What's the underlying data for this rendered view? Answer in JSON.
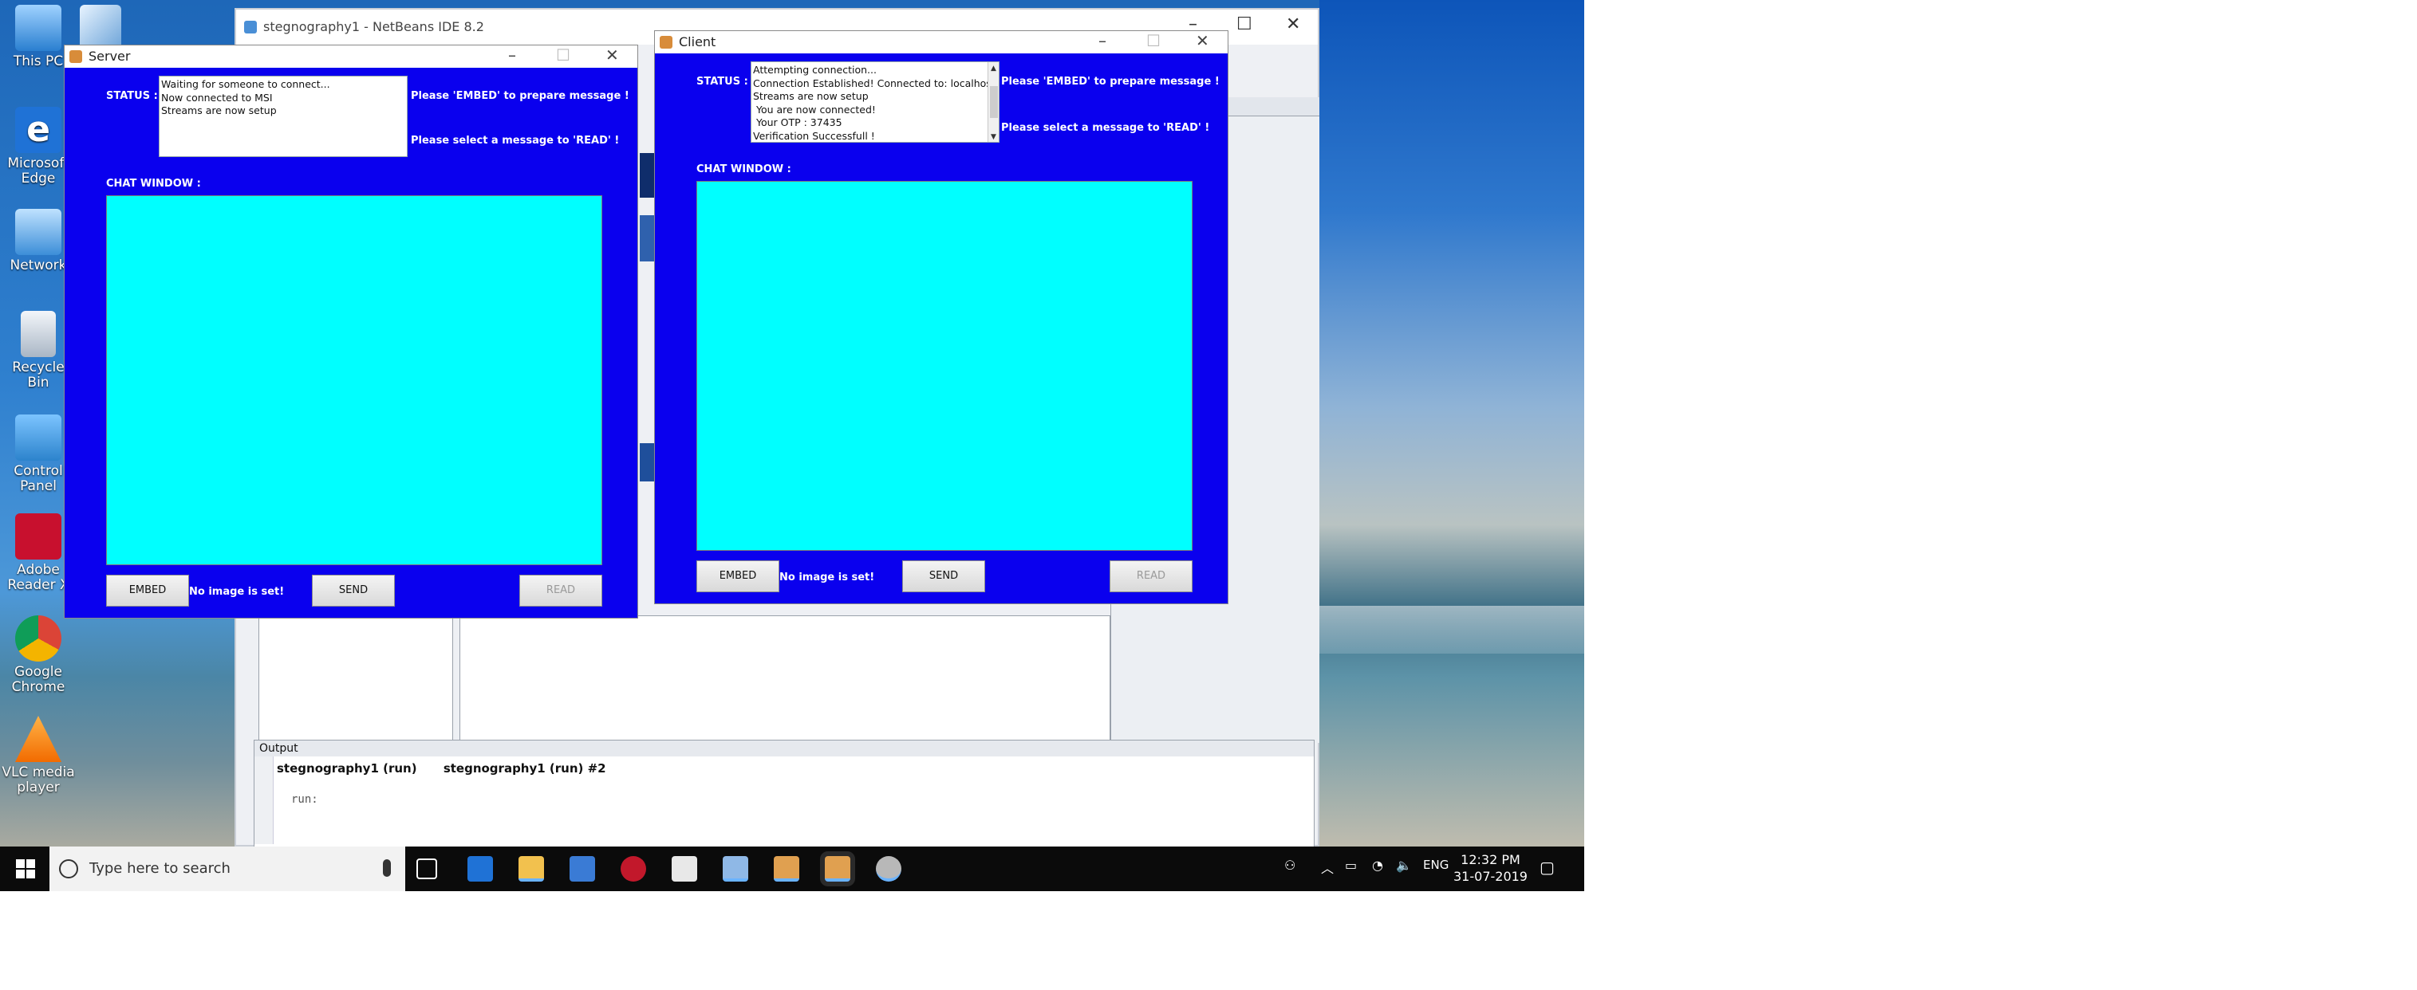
{
  "desktop": {
    "icons": [
      {
        "label": "This PC",
        "icon": "computer-icon"
      },
      {
        "label": "Microsoft Edge",
        "icon": "edge-icon"
      },
      {
        "label": "Network",
        "icon": "network-icon"
      },
      {
        "label": "Recycle Bin",
        "icon": "recycle-bin-icon"
      },
      {
        "label": "Control Panel",
        "icon": "control-panel-icon"
      },
      {
        "label": "Adobe Reader X",
        "icon": "acrobat-icon"
      },
      {
        "label": "Google Chrome",
        "icon": "chrome-icon"
      },
      {
        "label": "VLC media player",
        "icon": "vlc-icon"
      }
    ]
  },
  "netbeans": {
    "title": "stegnography1 - NetBeans IDE 8.2",
    "output_title": "Output",
    "tabs": [
      "stegnography1 (run)",
      "stegnography1 (run) #2"
    ],
    "output_text": "run:"
  },
  "server": {
    "title": "Server",
    "status_label": "STATUS :",
    "status_lines": [
      "Waiting for someone to connect...",
      "Now connected to MSI",
      "Streams are now setup"
    ],
    "hint_embed": "Please 'EMBED' to prepare message !",
    "hint_read": "Please select a message to 'READ' !",
    "chat_label": "CHAT WINDOW :",
    "embed_button": "EMBED",
    "no_image": "No image is set!",
    "send_button": "SEND",
    "read_button": "READ"
  },
  "client": {
    "title": "Client",
    "status_label": "STATUS :",
    "status_lines": [
      "Attempting connection...",
      "Connection Established! Connected to: localhost",
      "Streams are now setup",
      " You are now connected!",
      " Your OTP : 37435",
      "Verification Successfull !"
    ],
    "hint_embed": "Please 'EMBED' to prepare message !",
    "hint_read": "Please select a message to 'READ' !",
    "chat_label": "CHAT WINDOW :",
    "embed_button": "EMBED",
    "no_image": "No image is set!",
    "send_button": "SEND",
    "read_button": "READ"
  },
  "taskbar": {
    "search_placeholder": "Type here to search",
    "language": "ENG",
    "time": "12:32 PM",
    "date": "31-07-2019"
  },
  "colors": {
    "window_bg": "#0a00ee",
    "chat_bg": "#00ffff",
    "taskbar_bg": "#0b0b0b"
  }
}
